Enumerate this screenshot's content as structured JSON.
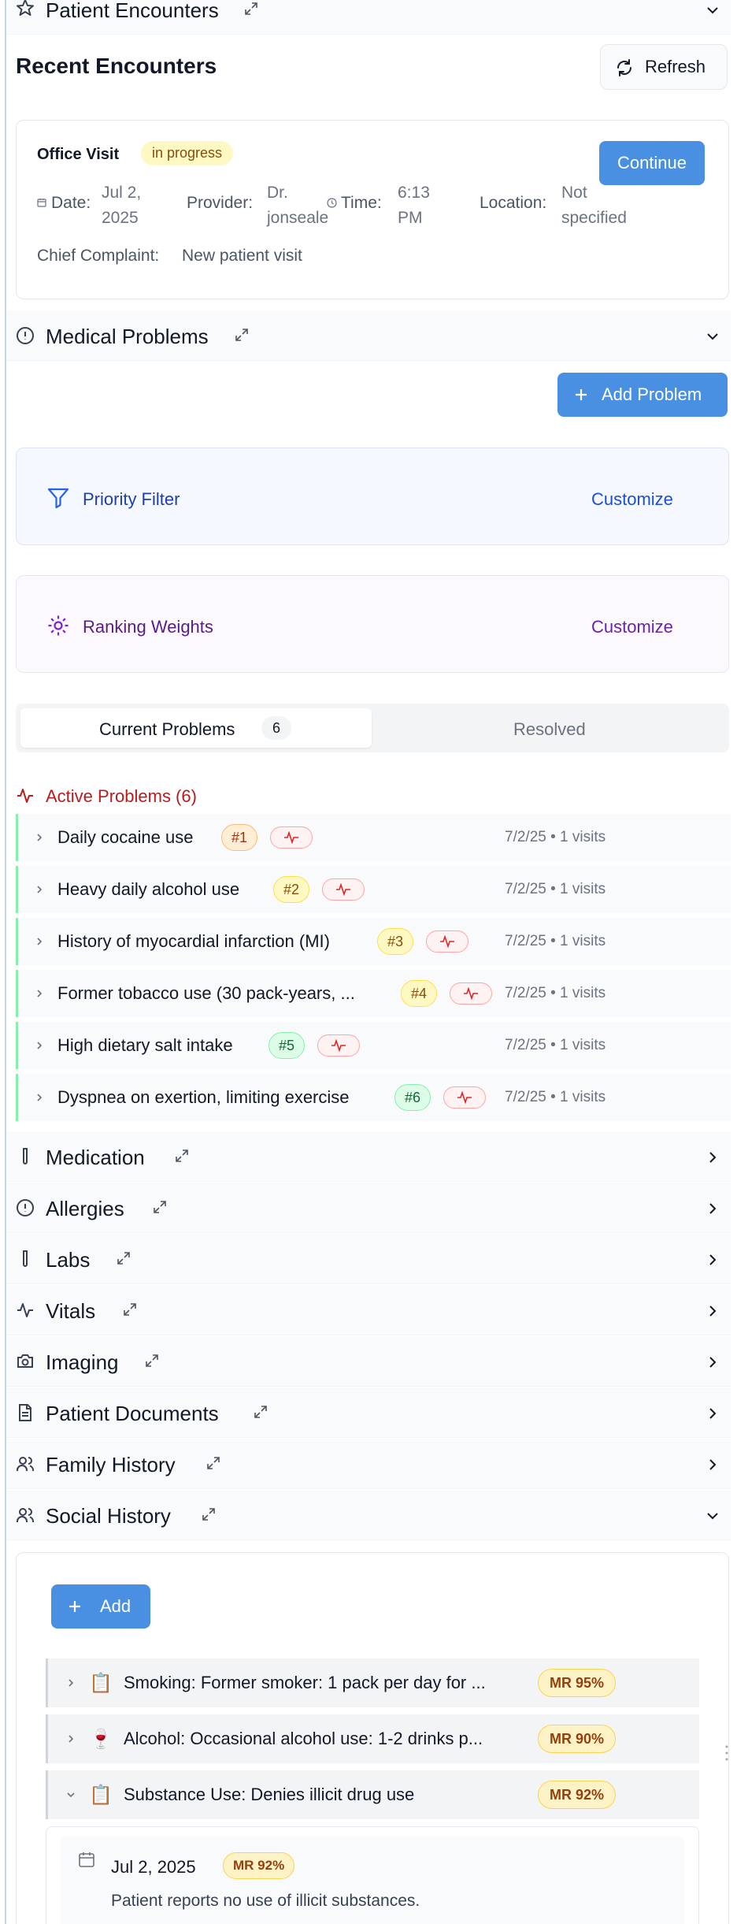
{
  "encounters": {
    "section_title": "Patient Encounters",
    "heading": "Recent Encounters",
    "refresh_label": "Refresh",
    "visit": {
      "type": "Office Visit",
      "status": "in progress",
      "continue_label": "Continue",
      "date_label": "Date:",
      "date_value": "Jul 2, 2025",
      "provider_label": "Provider:",
      "provider_value": "Dr. jonseale",
      "time_label": "Time:",
      "time_value": "6:13 PM",
      "location_label": "Location:",
      "location_value": "Not specified",
      "complaint_label": "Chief Complaint:",
      "complaint_value": "New patient visit"
    }
  },
  "medical_problems": {
    "section_title": "Medical Problems",
    "add_label": "Add Problem",
    "priority_filter_label": "Priority Filter",
    "priority_customize": "Customize",
    "ranking_weights_label": "Ranking Weights",
    "ranking_customize": "Customize",
    "tab_current": "Current Problems",
    "tab_current_count": "6",
    "tab_resolved": "Resolved",
    "active_header": "Active Problems (6)",
    "problems": [
      {
        "name": "Daily cocaine use",
        "rank": "#1",
        "meta": "7/2/25 • 1 visits"
      },
      {
        "name": "Heavy daily alcohol use",
        "rank": "#2",
        "meta": "7/2/25 • 1 visits"
      },
      {
        "name": "History of myocardial infarction (MI)",
        "rank": "#3",
        "meta": "7/2/25 • 1 visits"
      },
      {
        "name": "Former tobacco use (30 pack-years, ...",
        "rank": "#4",
        "meta": "7/2/25 • 1 visits"
      },
      {
        "name": "High dietary salt intake",
        "rank": "#5",
        "meta": "7/2/25 • 1 visits"
      },
      {
        "name": "Dyspnea on exertion, limiting exercise",
        "rank": "#6",
        "meta": "7/2/25 • 1 visits"
      }
    ]
  },
  "sections": {
    "medication": "Medication",
    "allergies": "Allergies",
    "labs": "Labs",
    "vitals": "Vitals",
    "imaging": "Imaging",
    "documents": "Patient Documents",
    "family_history": "Family History",
    "social_history": "Social History"
  },
  "social_history": {
    "add_label": "Add",
    "items": [
      {
        "icon": "📋",
        "text": "Smoking: Former smoker: 1 pack per day for ...",
        "mr": "MR 95%"
      },
      {
        "icon": "🍷",
        "text": "Alcohol: Occasional alcohol use: 1-2 drinks p...",
        "mr": "MR 90%"
      },
      {
        "icon": "📋",
        "text": "Substance Use: Denies illicit drug use",
        "mr": "MR 92%"
      }
    ],
    "detail": {
      "date": "Jul 2, 2025",
      "mr": "MR 92%",
      "note": "Patient reports no use of illicit substances."
    }
  },
  "colors": {
    "accent": "#4a90e2",
    "active_problem_red": "#b91c1c",
    "purple": "#6b21a8",
    "priority_blue": "#1e40af"
  }
}
